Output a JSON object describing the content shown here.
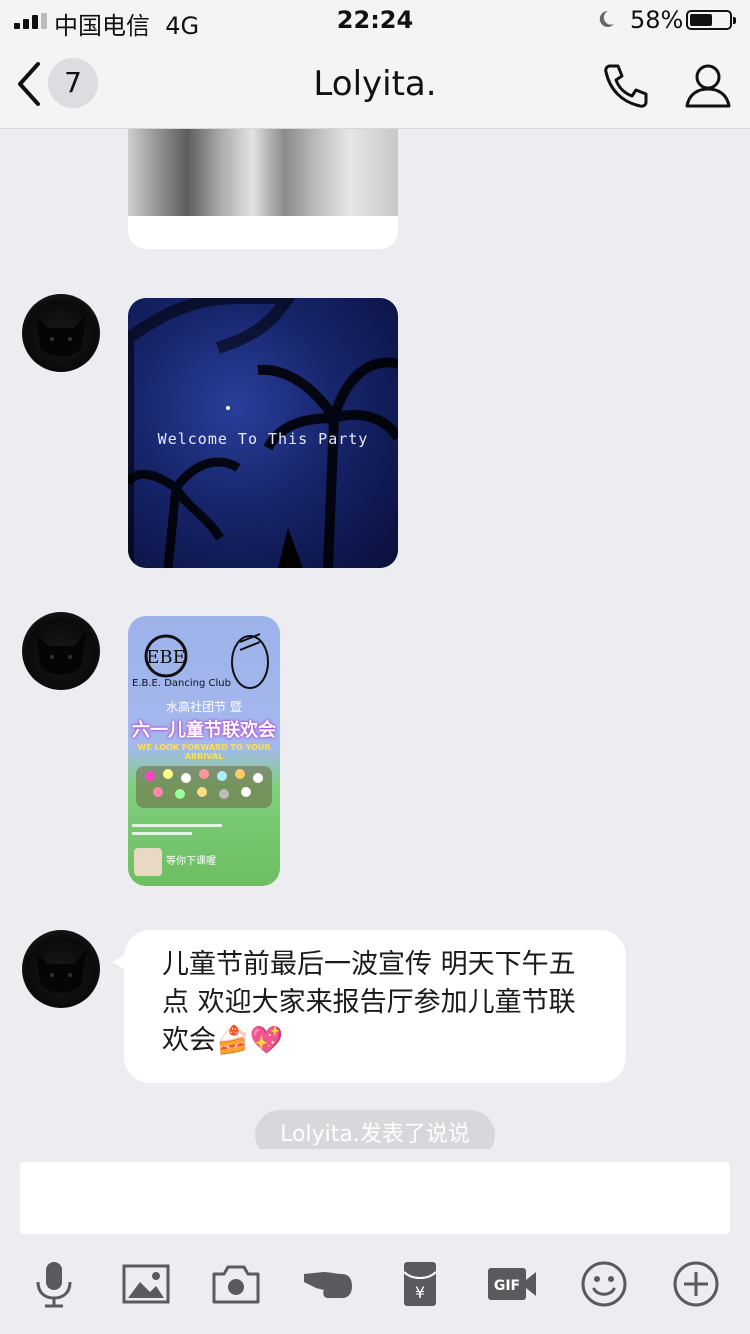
{
  "status_bar": {
    "carrier": "中国电信",
    "network": "4G",
    "time": "22:24",
    "battery_percent": "58%",
    "battery_level": 0.58
  },
  "nav": {
    "back_badge": "7",
    "title": "Lolyita."
  },
  "chat": {
    "party_image_text": "Welcome To This Party",
    "poster": {
      "club": "E.B.E. Dancing Club",
      "line1": "水高社团节 暨",
      "line2": "六一儿童节联欢会",
      "line3": "WE LOOK FORWARD TO YOUR ARRIVAL",
      "caption": "等你下课喔"
    },
    "message_text": "儿童节前最后一波宣传 明天下午五点 欢迎大家来报告厅参加儿童节联欢会🍰💖",
    "system_note": "Lolyita.发表了说说"
  },
  "input": {
    "value": ""
  },
  "colors": {
    "background": "#ececf1",
    "bar": "#f4f4f7",
    "icon": "#5a5a5e"
  },
  "icons": [
    "microphone-icon",
    "image-icon",
    "camera-icon",
    "poke-icon",
    "red-packet-icon",
    "gif-icon",
    "emoji-icon",
    "plus-icon"
  ]
}
